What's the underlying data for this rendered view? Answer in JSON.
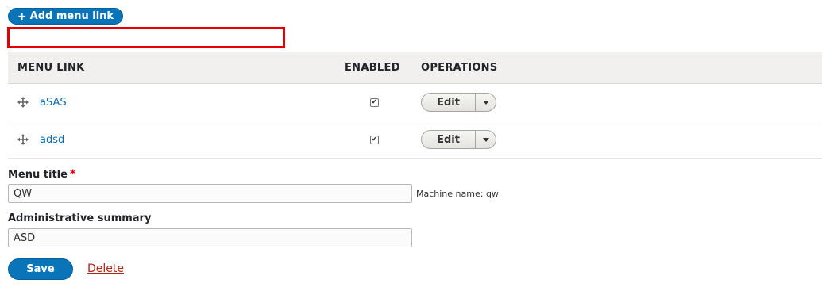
{
  "toolbar": {
    "add_link_label": "Add menu link",
    "add_link_icon": "+"
  },
  "table": {
    "headers": [
      "MENU LINK",
      "ENABLED",
      "OPERATIONS"
    ],
    "rows": [
      {
        "label": "aSAS",
        "enabled": true,
        "operation": "Edit"
      },
      {
        "label": "adsd",
        "enabled": true,
        "operation": "Edit"
      }
    ]
  },
  "form": {
    "menu_title_label": "Menu title",
    "required_mark": "*",
    "menu_title_value": "QW",
    "machine_name": "Machine name: qw",
    "summary_label": "Administrative summary",
    "summary_value": "ASD",
    "save_label": "Save",
    "delete_label": "Delete"
  },
  "colors": {
    "primary": "#0a74b8",
    "link": "#0a6eb4",
    "danger": "#b2231a",
    "highlight": "#e00000"
  }
}
